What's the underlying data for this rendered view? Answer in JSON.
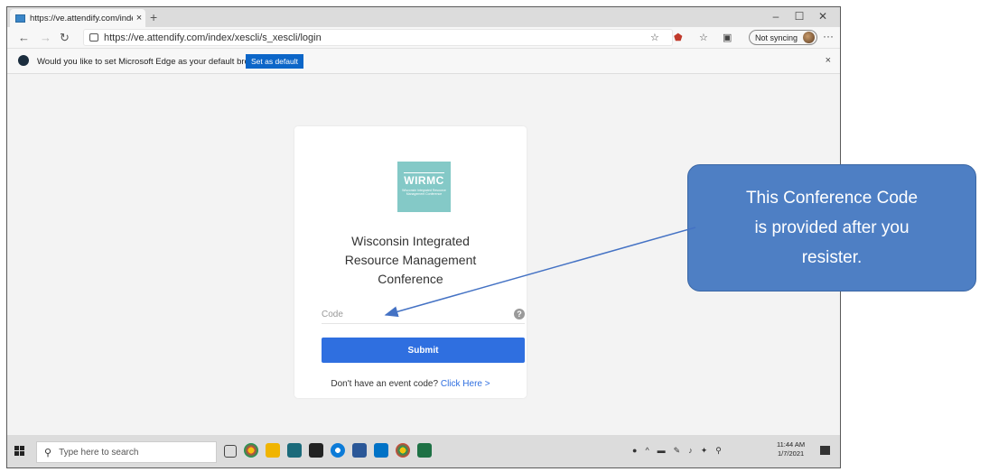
{
  "browser": {
    "tab_title": "https://ve.attendify.com/index/xesc",
    "tab_close": "×",
    "new_tab": "+",
    "url": "https://ve.attendify.com/index/xescli/s_xescli/login",
    "sync_label": "Not syncing",
    "more": "···",
    "window_controls": {
      "minimize": "–",
      "maximize": "☐",
      "close": "✕"
    }
  },
  "infobar": {
    "message": "Would you like to set Microsoft Edge as your default browser?",
    "button": "Set as default",
    "close": "×"
  },
  "login": {
    "logo_text": "WIRMC",
    "logo_subtext": "Wisconsin Integrated Resource Management Conference",
    "org_line1": "Wisconsin Integrated",
    "org_line2": "Resource Management",
    "org_line3": "Conference",
    "code_placeholder": "Code",
    "help_icon": "?",
    "submit_label": "Submit",
    "no_code_text": "Don't have an event code?",
    "click_here": "Click Here",
    "click_here_chevron": ">"
  },
  "taskbar": {
    "search_placeholder": "Type here to search",
    "time": "11:44 AM",
    "date": "1/7/2021"
  },
  "callout": {
    "line1": "This Conference Code",
    "line2": "is provided after you",
    "line3": "resister."
  },
  "colors": {
    "accent": "#2f6fe0",
    "callout": "#4e7fc4",
    "logo_bg": "#84c9c7"
  }
}
